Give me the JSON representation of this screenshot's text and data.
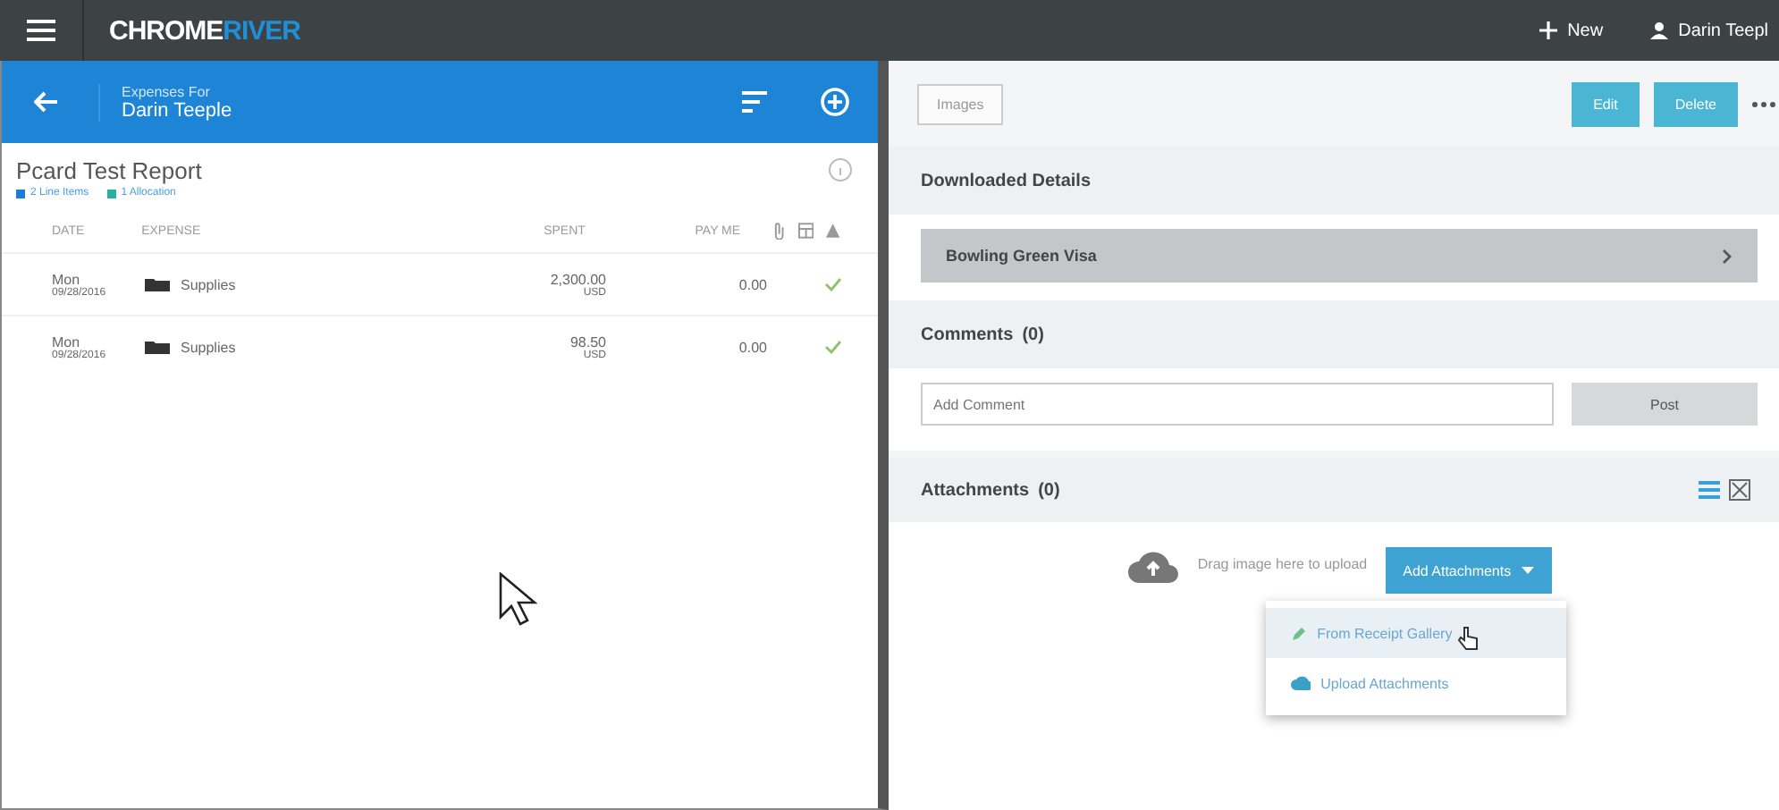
{
  "topbar": {
    "logo_part_1": "CHROME",
    "logo_part_2": "RIVER",
    "new_label": "New",
    "user": "Darin Teepl"
  },
  "report_header": {
    "caption": "Expenses For",
    "name": "Darin Teeple"
  },
  "report": {
    "title": "Pcard Test Report",
    "tags": [
      {
        "label": "2 Line Items",
        "color": "#1a7fd4"
      },
      {
        "label": "1 Allocation",
        "color": "#2ab0a0"
      }
    ],
    "columns": [
      "DATE",
      "EXPENSE",
      "SPENT",
      "PAY ME"
    ],
    "rows": [
      {
        "day": "Mon",
        "date": "09/28/2016",
        "expense": "Supplies",
        "spent": "2,300.00",
        "currency": "USD",
        "pay_me": "0.00"
      },
      {
        "day": "Mon",
        "date": "09/28/2016",
        "expense": "Supplies",
        "spent": "98.50",
        "currency": "USD",
        "pay_me": "0.00"
      }
    ]
  },
  "detail": {
    "images_button": "Images",
    "edit_button": "Edit",
    "delete_button": "Delete",
    "downloaded_title": "Downloaded Details",
    "card": "Bowling Green Visa",
    "comments_title": "Comments",
    "comments_count": "(0)",
    "comment_placeholder": "Add Comment",
    "post_button": "Post",
    "attachments_title": "Attachments",
    "attachments_count": "(0)",
    "drop_hint": "Drag image here to upload",
    "add_button": "Add Attachments",
    "menu": [
      {
        "label": "From Receipt Gallery",
        "selected": true,
        "kind": "gallery"
      },
      {
        "label": "Upload Attachments",
        "selected": false,
        "kind": "upload"
      }
    ]
  }
}
